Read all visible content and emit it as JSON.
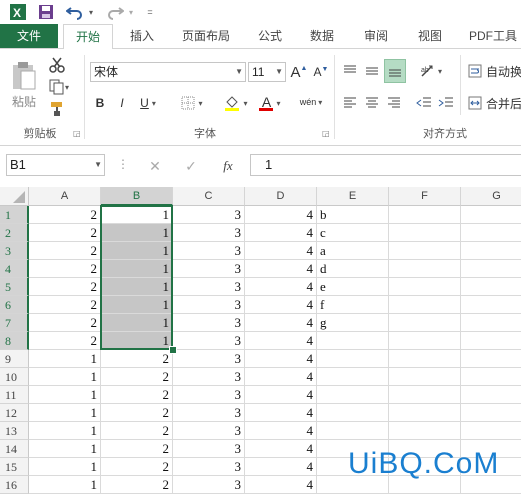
{
  "colors": {
    "excel_green": "#217346",
    "selection_gray": "#c6c6c6",
    "watermark_blue": "#1a7fd0"
  },
  "qat": {
    "icons": [
      "excel-logo-icon",
      "save-icon",
      "undo-icon",
      "redo-icon",
      "customize-icon"
    ]
  },
  "tabs": [
    "文件",
    "开始",
    "插入",
    "页面布局",
    "公式",
    "数据",
    "审阅",
    "视图",
    "PDF工具"
  ],
  "ribbon": {
    "clipboard": {
      "paste_label": "粘贴",
      "group_label": "剪贴板"
    },
    "font": {
      "font_name": "宋体",
      "font_size": "11",
      "bold": "B",
      "italic": "I",
      "underline": "U",
      "grow": "A",
      "shrink": "A",
      "color_letter": "A",
      "phonetic": "wén",
      "group_label": "字体"
    },
    "alignment": {
      "wrap_label": "自动换",
      "merge_label": "合并后",
      "group_label": "对齐方式"
    }
  },
  "formula_bar": {
    "name_box": "B1",
    "fx": "fx",
    "value": "1"
  },
  "grid": {
    "columns": [
      "A",
      "B",
      "C",
      "D",
      "E",
      "F",
      "G"
    ],
    "selected_column": "B",
    "rows": [
      {
        "n": "1",
        "a": "2",
        "b": "1",
        "c": "3",
        "d": "4",
        "e": "b"
      },
      {
        "n": "2",
        "a": "2",
        "b": "1",
        "c": "3",
        "d": "4",
        "e": "c"
      },
      {
        "n": "3",
        "a": "2",
        "b": "1",
        "c": "3",
        "d": "4",
        "e": "a"
      },
      {
        "n": "4",
        "a": "2",
        "b": "1",
        "c": "3",
        "d": "4",
        "e": "d"
      },
      {
        "n": "5",
        "a": "2",
        "b": "1",
        "c": "3",
        "d": "4",
        "e": "e"
      },
      {
        "n": "6",
        "a": "2",
        "b": "1",
        "c": "3",
        "d": "4",
        "e": "f"
      },
      {
        "n": "7",
        "a": "2",
        "b": "1",
        "c": "3",
        "d": "4",
        "e": "g"
      },
      {
        "n": "8",
        "a": "2",
        "b": "1",
        "c": "3",
        "d": "4",
        "e": ""
      },
      {
        "n": "9",
        "a": "1",
        "b": "2",
        "c": "3",
        "d": "4",
        "e": ""
      },
      {
        "n": "10",
        "a": "1",
        "b": "2",
        "c": "3",
        "d": "4",
        "e": ""
      },
      {
        "n": "11",
        "a": "1",
        "b": "2",
        "c": "3",
        "d": "4",
        "e": ""
      },
      {
        "n": "12",
        "a": "1",
        "b": "2",
        "c": "3",
        "d": "4",
        "e": ""
      },
      {
        "n": "13",
        "a": "1",
        "b": "2",
        "c": "3",
        "d": "4",
        "e": ""
      },
      {
        "n": "14",
        "a": "1",
        "b": "2",
        "c": "3",
        "d": "4",
        "e": ""
      },
      {
        "n": "15",
        "a": "1",
        "b": "2",
        "c": "3",
        "d": "4",
        "e": ""
      },
      {
        "n": "16",
        "a": "1",
        "b": "2",
        "c": "3",
        "d": "4",
        "e": ""
      }
    ]
  },
  "watermark": "UiBQ.CoM"
}
